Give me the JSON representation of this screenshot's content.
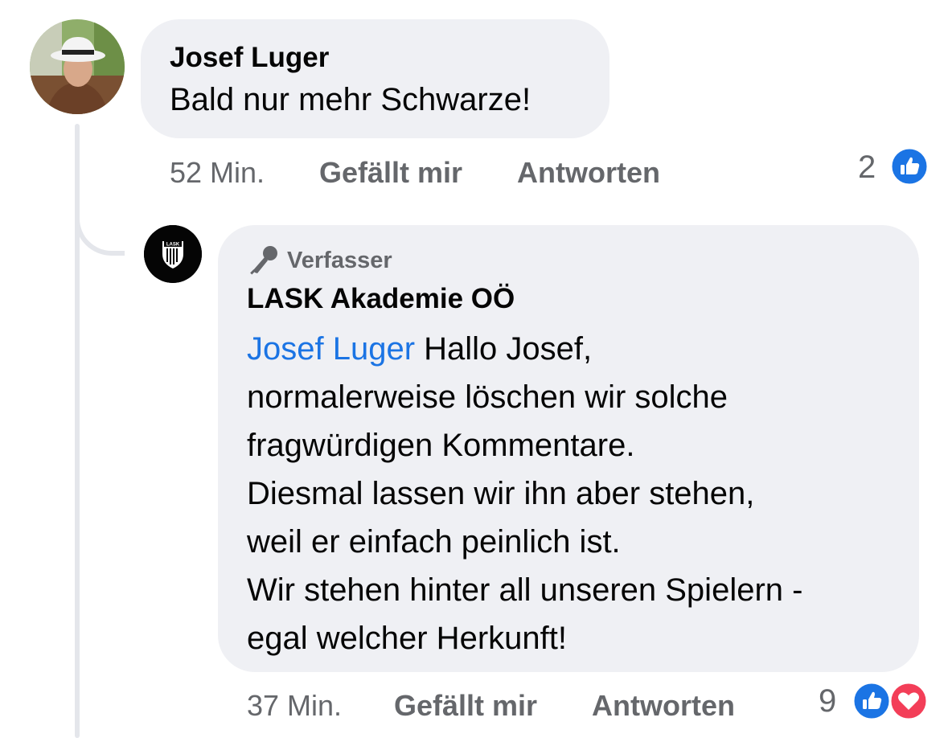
{
  "comment": {
    "author": "Josef Luger",
    "text": "Bald nur mehr Schwarze!",
    "time": "52 Min.",
    "like_label": "Gefällt mir",
    "reply_label": "Antworten",
    "reaction_count": "2",
    "reactions": [
      "like-icon"
    ]
  },
  "reply": {
    "badge_label": "Verfasser",
    "author": "LASK Akademie OÖ",
    "logo_text": "LASK",
    "mention": "Josef Luger",
    "lines": [
      " Hallo Josef,",
      "normalerweise löschen wir solche",
      "fragwürdigen Kommentare.",
      "Diesmal lassen wir ihn aber stehen,",
      "weil er einfach peinlich ist.",
      "Wir stehen hinter all unseren Spielern -",
      "egal welcher Herkunft!"
    ],
    "time": "37 Min.",
    "like_label": "Gefällt mir",
    "reply_label": "Antworten",
    "reaction_count": "9",
    "reactions": [
      "like-icon",
      "heart-icon"
    ]
  },
  "colors": {
    "bubble": "#eff0f4",
    "meta_text": "#65676b",
    "mention": "#1b74e4",
    "like_blue": "#1b74e4",
    "heart_red": "#f33e58",
    "thread_line": "#e4e6eb"
  }
}
